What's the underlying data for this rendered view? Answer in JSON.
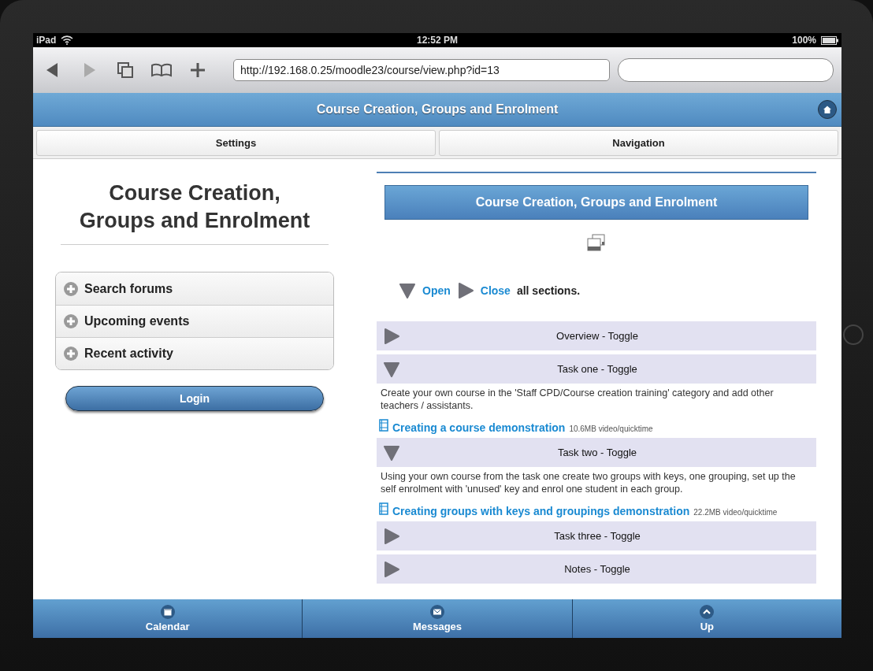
{
  "status_bar": {
    "device": "iPad",
    "time": "12:52 PM",
    "battery": "100%"
  },
  "browser": {
    "url": "http://192.168.0.25/moodle23/course/view.php?id=13"
  },
  "header": {
    "title": "Course Creation, Groups and Enrolment"
  },
  "nav_buttons": [
    "Settings",
    "Navigation"
  ],
  "sidebar": {
    "title": "Course Creation, Groups and Enrolment",
    "blocks": [
      {
        "label": "Search forums",
        "expanded": false
      },
      {
        "label": "Upcoming events",
        "expanded": false
      },
      {
        "label": "Recent activity",
        "expanded": false
      }
    ],
    "login": "Login"
  },
  "course": {
    "banner": "Course Creation, Groups and Enrolment",
    "toggle_all": {
      "open": "Open",
      "close": "Close",
      "suffix": "all sections."
    },
    "sections": [
      {
        "title": "Overview - Toggle",
        "expanded": false
      },
      {
        "title": "Task one - Toggle",
        "expanded": true,
        "summary": "Create your own course in the 'Staff CPD/Course creation training' category and add other teachers / assistants.",
        "resource": {
          "name": "Creating a course demonstration",
          "info": "10.6MB video/quicktime"
        }
      },
      {
        "title": "Task two - Toggle",
        "expanded": true,
        "summary": "Using your own course from the task one create two groups with keys, one grouping, set up the self enrolment with 'unused' key and enrol one student in each group.",
        "resource": {
          "name": "Creating groups with keys and groupings demonstration",
          "info": "22.2MB video/quicktime"
        }
      },
      {
        "title": "Task three - Toggle",
        "expanded": false
      },
      {
        "title": "Notes - Toggle",
        "expanded": false
      }
    ]
  },
  "footer": [
    {
      "kind": "calendar",
      "label": "Calendar"
    },
    {
      "kind": "messages",
      "label": "Messages"
    },
    {
      "kind": "up",
      "label": "Up"
    }
  ]
}
